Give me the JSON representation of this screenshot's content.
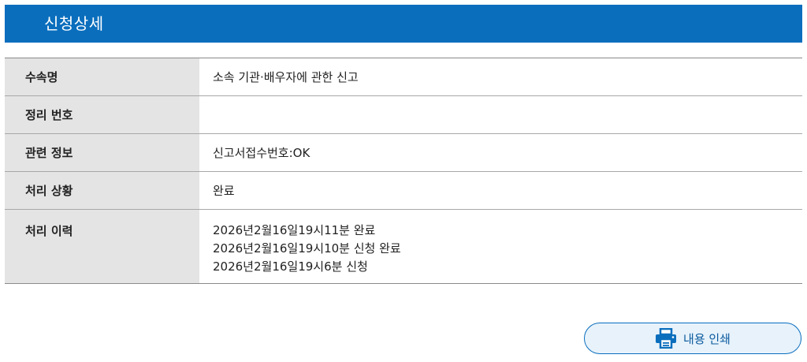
{
  "header": {
    "title": "신청상세"
  },
  "details": {
    "rows": [
      {
        "label": "수속명",
        "value": "소속 기관·배우자에 관한 신고"
      },
      {
        "label": "정리 번호",
        "value": ""
      },
      {
        "label": "관련 정보",
        "value": "신고서접수번호:OK"
      },
      {
        "label": "처리 상황",
        "value": "완료"
      }
    ],
    "history": {
      "label": "처리 이력",
      "entries": [
        "2026년2월16일19시11분  완료",
        "2026년2월16일19시10분  신청 완료",
        "2026년2월16일19시6분  신청"
      ]
    }
  },
  "print_button": {
    "label": "내용 인쇄",
    "icon": "printer-icon"
  },
  "colors": {
    "header_bg": "#0a6ebd",
    "label_bg": "#e4e4e4",
    "button_bg": "#e7f2fb",
    "button_border": "#0a6ebd"
  }
}
